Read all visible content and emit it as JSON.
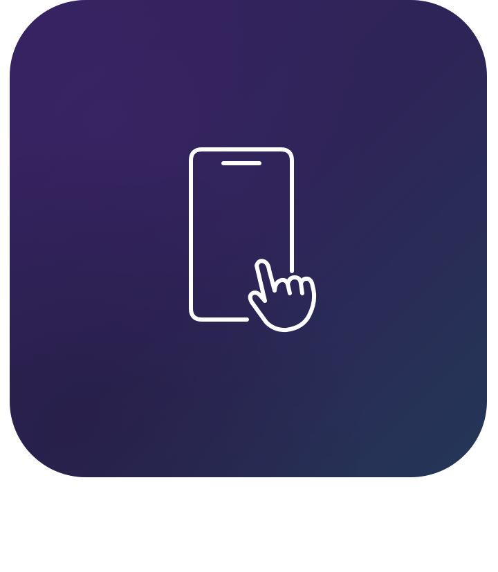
{
  "app_icon": {
    "icon": "touch-phone-icon",
    "colors": {
      "gradient_top_left": "#35225f",
      "gradient_mid": "#2e2457",
      "gradient_bottom_left": "#2a1f4d",
      "gradient_bottom_right": "#233756",
      "glyph_stroke": "#ffffff",
      "page_background": "#ffffff"
    }
  }
}
